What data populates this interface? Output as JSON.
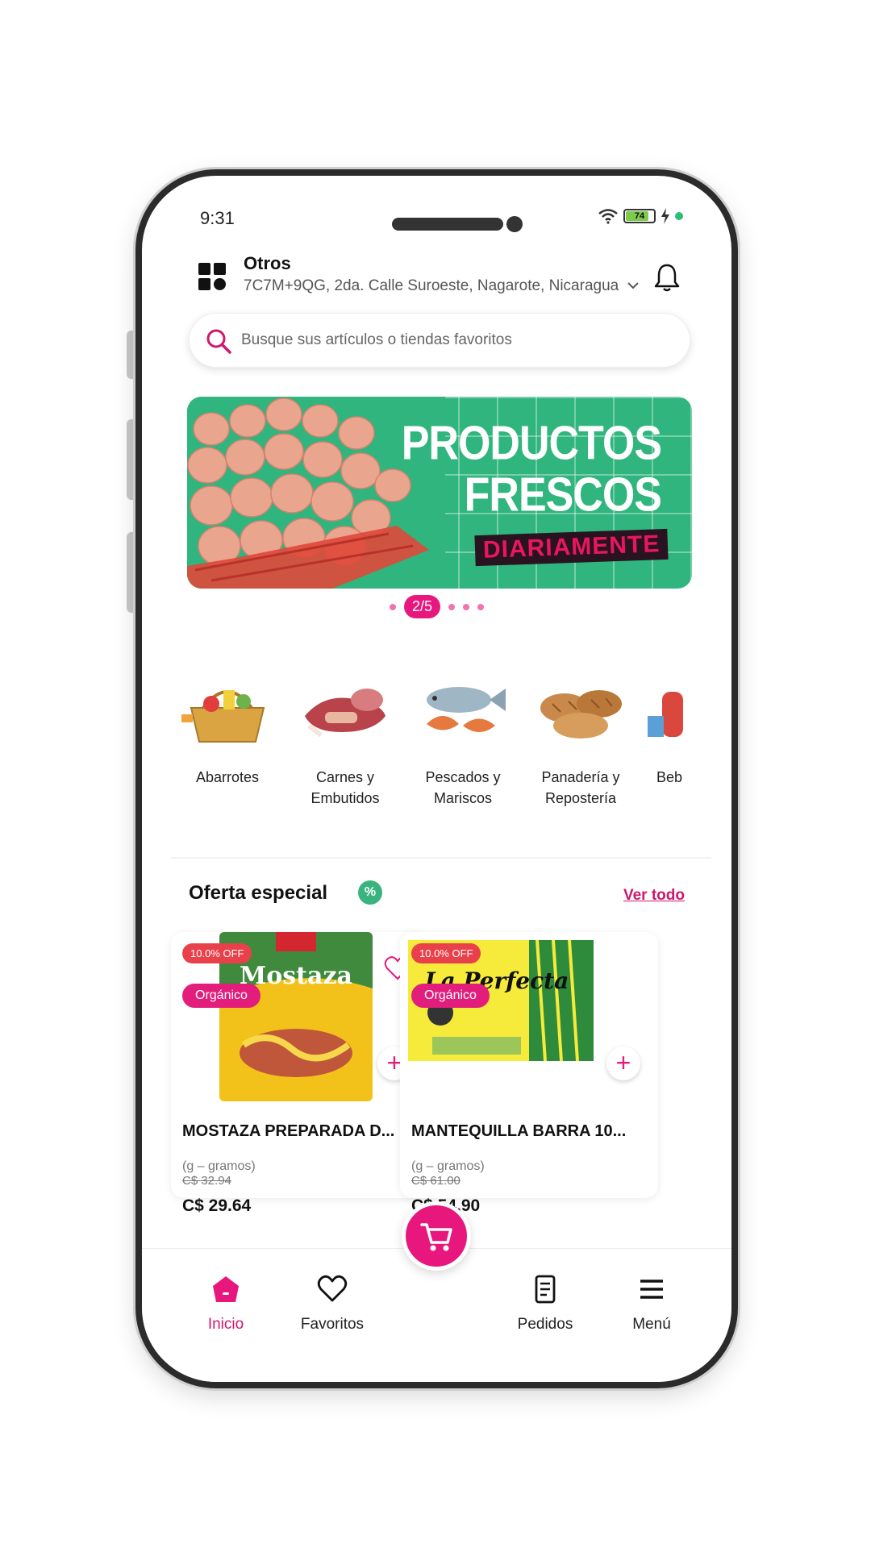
{
  "status_bar": {
    "time": "9:31",
    "battery": "74"
  },
  "header": {
    "location_title": "Otros",
    "address": "7C7M+9QG, 2da. Calle Suroeste, Nagarote, Nicaragua"
  },
  "search": {
    "placeholder": "Busque sus artículos o tiendas favoritos"
  },
  "banner": {
    "line1": "PRODUCTOS",
    "line2": "FRESCOS",
    "line3": "DIARIAMENTE",
    "pager": "2/5"
  },
  "categories": [
    {
      "label_1": "Abarrotes",
      "label_2": "",
      "icon": "basket-icon"
    },
    {
      "label_1": "Carnes y",
      "label_2": "Embutidos",
      "icon": "meat-icon"
    },
    {
      "label_1": "Pescados y",
      "label_2": "Mariscos",
      "icon": "fish-icon"
    },
    {
      "label_1": "Panadería y",
      "label_2": "Repostería",
      "icon": "bread-icon"
    },
    {
      "label_1": "Beb",
      "label_2": "",
      "icon": "drinks-icon"
    }
  ],
  "offers": {
    "title": "Oferta especial",
    "see_all": "Ver todo",
    "products": [
      {
        "discount": "10.0% OFF",
        "tag": "Orgánico",
        "name": "MOSTAZA PREPARADA D...",
        "unit": "(g – gramos)",
        "old_price": "C$ 32.94",
        "price": "C$ 29.64",
        "image_text": "Mostaza",
        "image_colors": [
          "#f3c21a",
          "#3f8a3c"
        ]
      },
      {
        "discount": "10.0% OFF",
        "tag": "Orgánico",
        "name": "MANTEQUILLA BARRA 10...",
        "unit": "(g – gramos)",
        "old_price": "C$ 61.00",
        "price": "C$ 54.90",
        "image_text": "La Perfecta",
        "image_colors": [
          "#f6ea3a",
          "#2e8b3c"
        ]
      }
    ]
  },
  "nav": {
    "home": "Inicio",
    "favorites": "Favoritos",
    "orders": "Pedidos",
    "menu": "Menú"
  },
  "colors": {
    "accent": "#e8177d",
    "banner_green": "#2fb57d",
    "discount_red": "#e9414b"
  }
}
